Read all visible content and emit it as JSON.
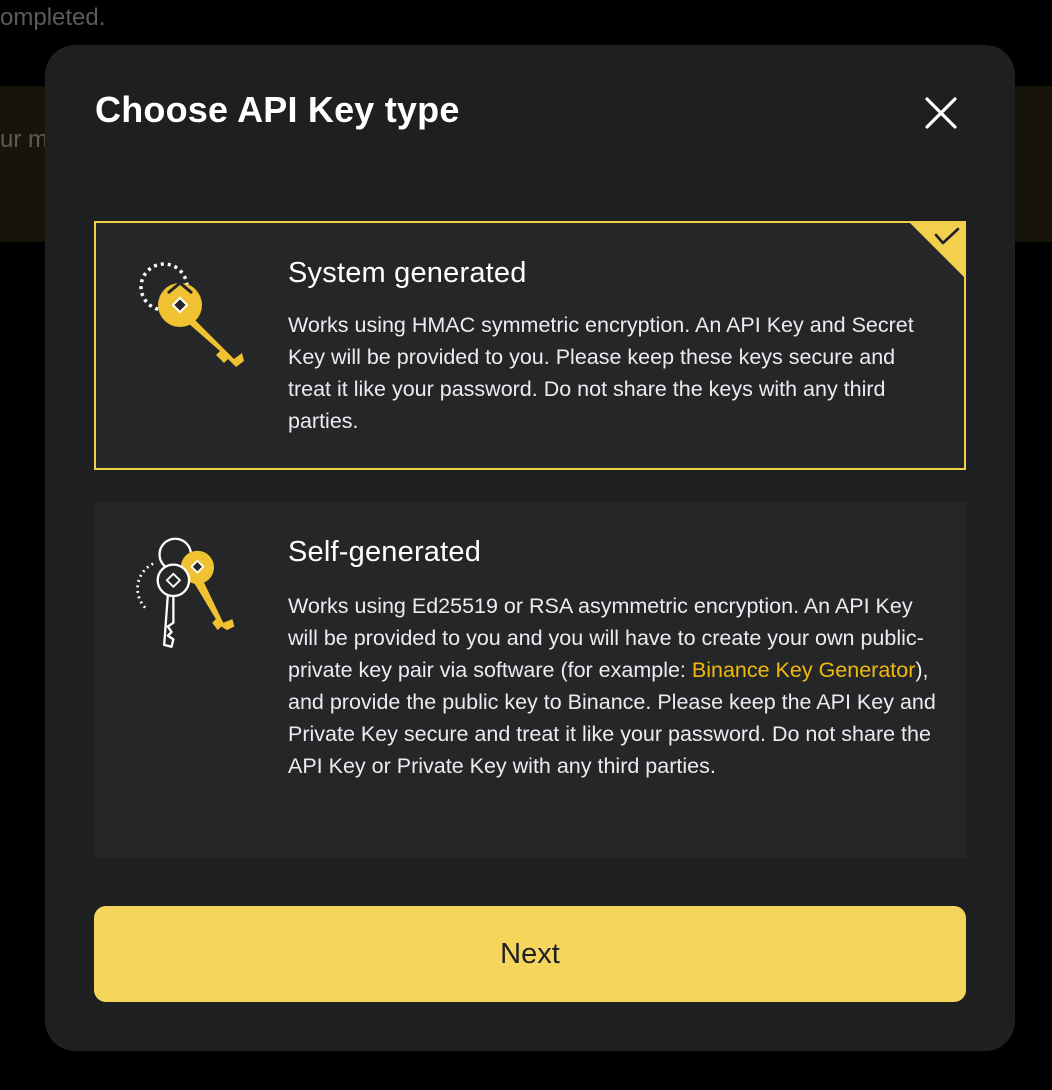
{
  "background": {
    "top_text": "ompleted.",
    "banner_text": "ur m"
  },
  "modal": {
    "title": "Choose API Key type",
    "close_icon": "close-icon"
  },
  "options": [
    {
      "title": "System generated",
      "description": "Works using HMAC symmetric encryption. An API Key and Secret Key will be provided to you. Please keep these keys secure and treat it like your password. Do not share the keys with any third parties.",
      "selected": true,
      "icon": "single-key-icon"
    },
    {
      "title": "Self-generated",
      "description_before_link": "Works using Ed25519 or RSA asymmetric encryption. An API Key will be provided to you and you will have to create your own public-private key pair via software (for example: ",
      "link_text": "Binance Key Generator",
      "description_after_link": "), and provide the public key to Binance. Please keep the API Key and Private Key secure and treat it like your password. Do not share the API Key or Private Key with any third parties.",
      "selected": false,
      "icon": "key-pair-icon"
    }
  ],
  "next_label": "Next",
  "colors": {
    "accent": "#f6d55c",
    "selected_border": "#f2d04b",
    "link": "#f0b90b",
    "modal_bg": "#1e1f21",
    "card_bg": "#252628"
  }
}
